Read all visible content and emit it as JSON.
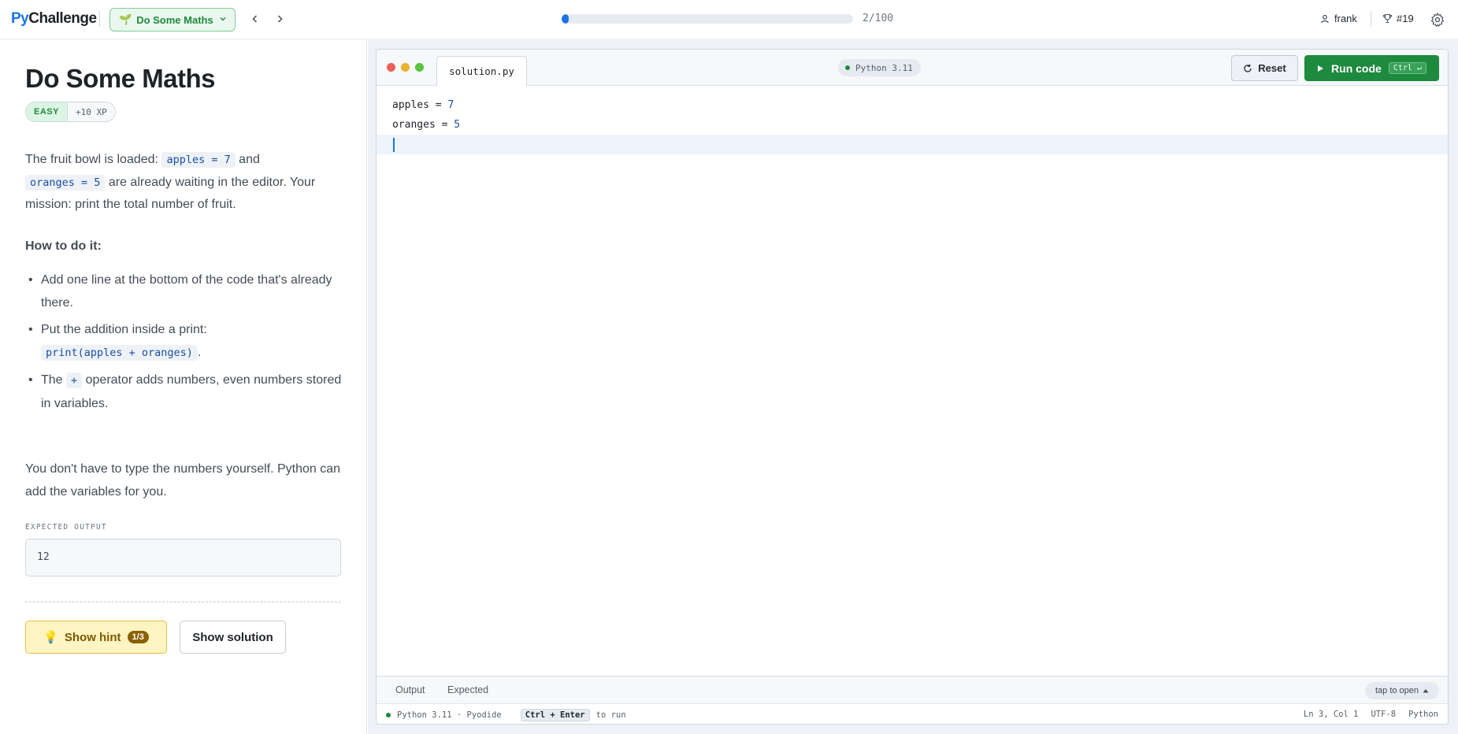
{
  "app": {
    "logo_py": "Py",
    "logo_rest": "Challenge",
    "challenge_pill": "Do Some Maths",
    "progress": {
      "text": "2/100",
      "fraction": 0.02
    },
    "user": "frank",
    "rank": "#19"
  },
  "problem": {
    "title": "Do Some Maths",
    "difficulty": "EASY",
    "xp": "+10 XP",
    "intro_1": "The fruit bowl is loaded:",
    "code_apples": "apples = 7",
    "intro_and": "and",
    "code_oranges": "oranges = 5",
    "intro_2": "are already waiting in the editor. Your mission: print the total number of fruit.",
    "howto_heading": "How to do it:",
    "tip_1": "Add one line at the bottom of the code that's already there.",
    "tip_2_text": "Put the addition inside a print:",
    "tip_2_code": "print(apples + oranges)",
    "tip_3_pre": "The",
    "tip_3_code": "+",
    "tip_3_post": "operator adds numbers, even numbers stored in variables.",
    "outro": "You don't have to type the numbers yourself. Python can add the variables for you.",
    "expected_label": "EXPECTED OUTPUT",
    "expected_value": "12",
    "hint_button": "Show hint",
    "hint_count": "1/3",
    "solution_button": "Show solution"
  },
  "editor": {
    "file_tab": "solution.py",
    "runtime_badge": "Python 3.11",
    "reset_button": "Reset",
    "run_button": "Run code",
    "run_shortcut": "Ctrl ↵",
    "lines": [
      {
        "var": "apples",
        "op": " = ",
        "num": "7"
      },
      {
        "var": "oranges",
        "op": " = ",
        "num": "5"
      }
    ],
    "output_tab": "Output",
    "expected_tab": "Expected",
    "tap_to_open": "tap to open",
    "status_runtime": "Python 3.11 · Pyodide",
    "status_kbd": "Ctrl + Enter",
    "status_hint": "to run",
    "cursor_pos": "Ln 3, Col 1",
    "encoding": "UTF-8",
    "language": "Python"
  },
  "colors": {
    "accent_blue": "#1a73e8",
    "run_green": "#1e8a3e",
    "easy_green": "#1f8a3b",
    "hint_yellow": "#fff5c2"
  }
}
